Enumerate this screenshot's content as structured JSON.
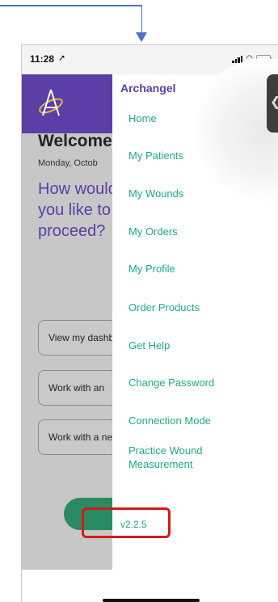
{
  "status_bar": {
    "time": "11:28"
  },
  "background": {
    "welcome": "Welcome,",
    "date": "Monday, Octob",
    "question": "How would you like to proceed?",
    "options": [
      "View my dashboard",
      "Work with an",
      "Work with a new"
    ]
  },
  "drawer": {
    "title": "Archangel",
    "items": [
      {
        "label": "Home"
      },
      {
        "label": "My Patients"
      },
      {
        "label": "My Wounds"
      },
      {
        "label": "My Orders"
      },
      {
        "label": "My Profile"
      },
      {
        "label": "Order Products"
      },
      {
        "label": "Get Help"
      },
      {
        "label": "Change Password"
      },
      {
        "label": "Connection Mode"
      },
      {
        "label": "Practice Wound Measurement"
      }
    ],
    "version": "v2.2.5"
  },
  "colors": {
    "brand_purple": "#5a3fa6",
    "menu_green": "#23a884",
    "highlight_red": "#d41a1a",
    "annotation_blue": "#4a72c4"
  }
}
